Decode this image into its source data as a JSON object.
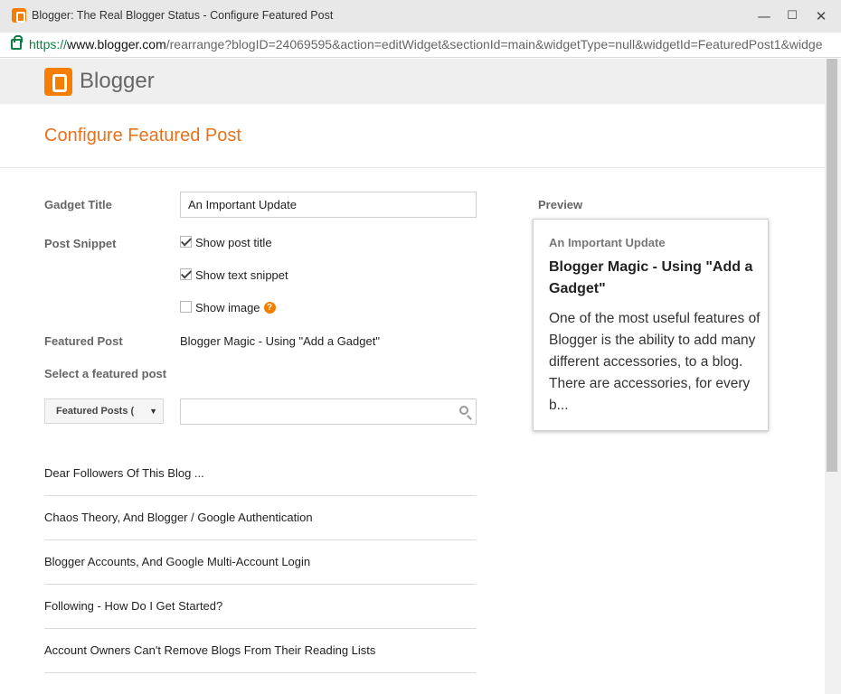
{
  "window": {
    "title": "Blogger: The Real Blogger Status - Configure Featured Post",
    "controls": {
      "minimize": "—",
      "maximize": "☐",
      "close": "✕"
    }
  },
  "address_bar": {
    "protocol": "https://",
    "host": "www.blogger.com",
    "path": "/rearrange?blogID=24069595&action=editWidget&sectionId=main&widgetType=null&widgetId=FeaturedPost1&widge"
  },
  "header": {
    "brand": "Blogger"
  },
  "page": {
    "title": "Configure Featured Post"
  },
  "form": {
    "gadget_title_label": "Gadget Title",
    "gadget_title_value": "An Important Update",
    "post_snippet_label": "Post Snippet",
    "show_post_title": "Show post title",
    "show_text_snippet": "Show text snippet",
    "show_image": "Show image",
    "help_glyph": "?",
    "featured_post_label": "Featured Post",
    "featured_post_value": "Blogger Magic - Using \"Add a Gadget\"",
    "select_label": "Select a featured post",
    "filter_select": "Featured Posts (",
    "filter_arrow": "▼",
    "search_placeholder": ""
  },
  "posts": [
    "Dear Followers Of This Blog ...",
    "Chaos Theory, And Blogger / Google Authentication",
    "Blogger Accounts, And Google Multi-Account Login",
    "Following - How Do I Get Started?",
    "Account Owners Can't Remove Blogs From Their Reading Lists"
  ],
  "preview": {
    "label": "Preview",
    "gadget_title": "An Important Update",
    "post_title": "Blogger Magic - Using \"Add a Gadget\"",
    "snippet": "One of the most useful features of Blogger is the ability to add many different accessories, to a blog. There are accessories, for every b..."
  },
  "colors": {
    "accent": "#e8711c",
    "brand": "#f57d00",
    "secure": "#0b8043"
  }
}
